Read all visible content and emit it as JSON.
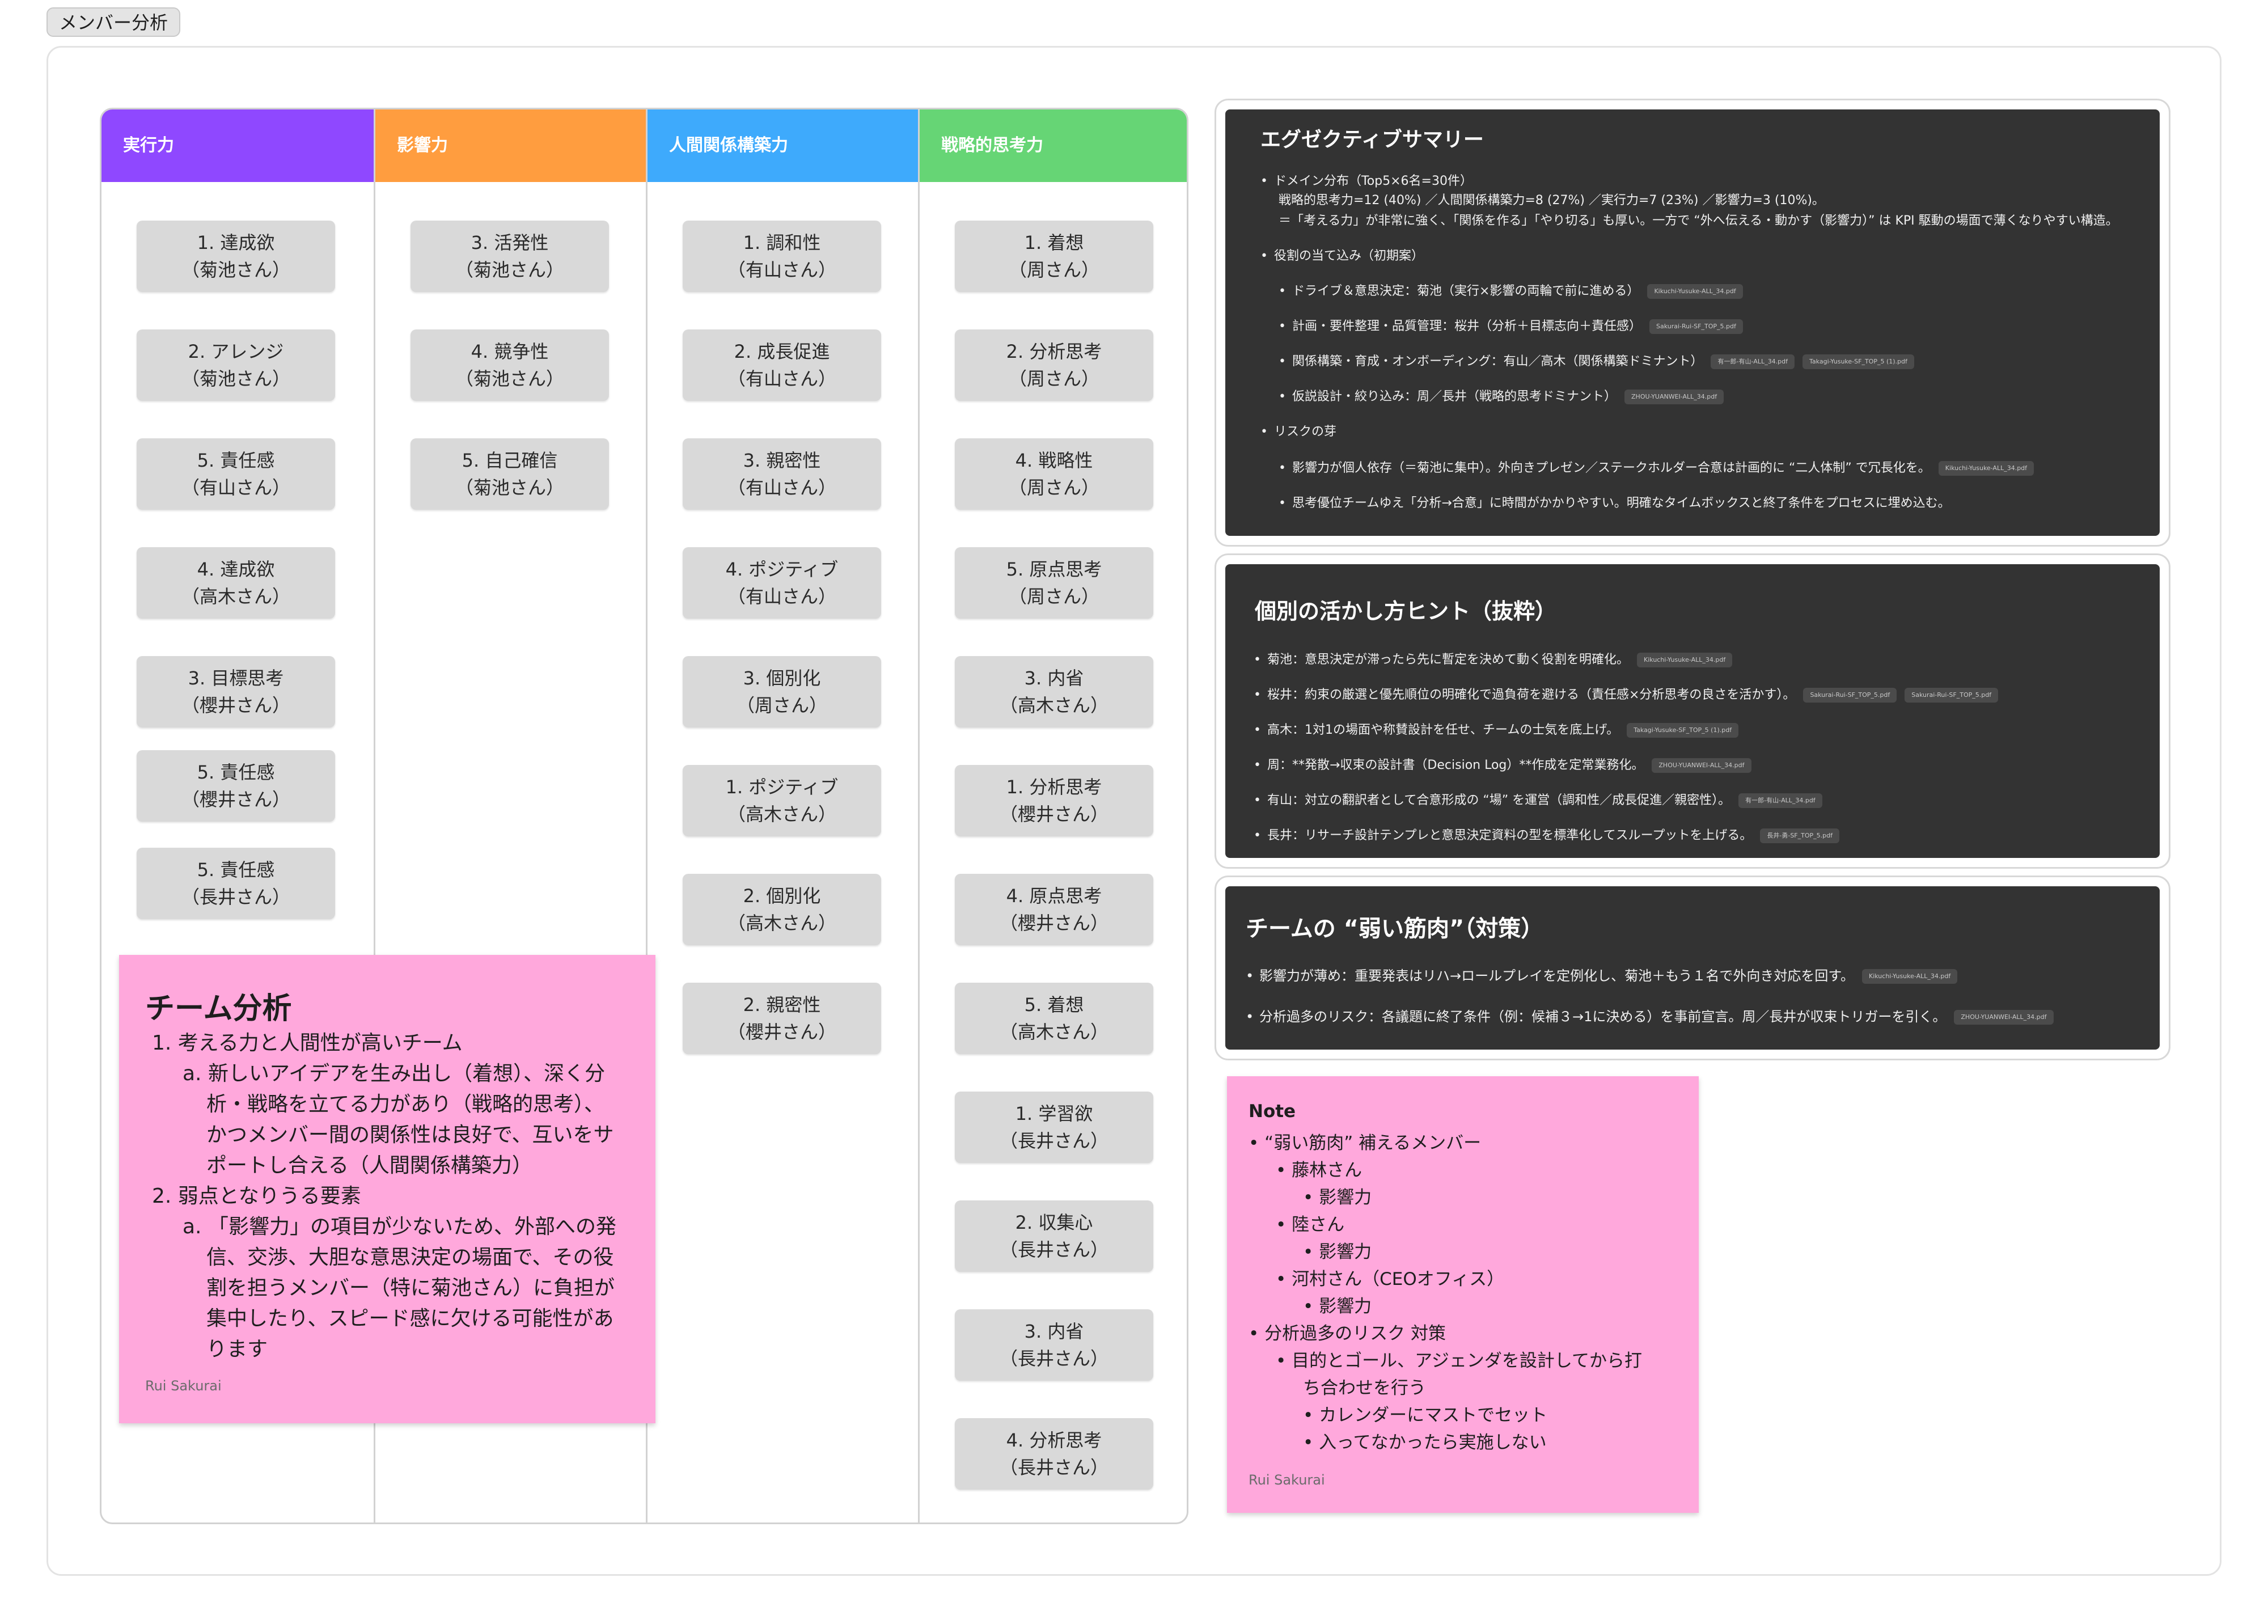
{
  "section": {
    "label": "メンバー分析"
  },
  "board": {
    "columns": [
      {
        "title": "実行力",
        "color": "#8f48ff",
        "cards": [
          [
            "1. 達成欲",
            "（菊池さん）"
          ],
          [
            "2. アレンジ",
            "（菊池さん）"
          ],
          [
            "5. 責任感",
            "（有山さん）"
          ],
          [
            "4. 達成欲",
            "（高木さん）"
          ],
          [
            "3. 目標思考",
            "（櫻井さん）"
          ],
          [
            "5. 責任感",
            "（櫻井さん）"
          ],
          [
            "5. 責任感",
            "（長井さん）"
          ]
        ]
      },
      {
        "title": "影響力",
        "color": "#ff9d3f",
        "cards": [
          [
            "3. 活発性",
            "（菊池さん）"
          ],
          [
            "4. 競争性",
            "（菊池さん）"
          ],
          [
            "5. 自己確信",
            "（菊池さん）"
          ]
        ]
      },
      {
        "title": "人間関係構築力",
        "color": "#3eaafc",
        "cards": [
          [
            "1. 調和性",
            "（有山さん）"
          ],
          [
            "2. 成長促進",
            "（有山さん）"
          ],
          [
            "3. 親密性",
            "（有山さん）"
          ],
          [
            "4. ポジティブ",
            "（有山さん）"
          ],
          [
            "3. 個別化",
            "（周さん）"
          ],
          [
            "1. ポジティブ",
            "（高木さん）"
          ],
          [
            "2. 個別化",
            "（高木さん）"
          ],
          [
            "2. 親密性",
            "（櫻井さん）"
          ]
        ]
      },
      {
        "title": "戦略的思考力",
        "color": "#66d575",
        "cards": [
          [
            "1. 着想",
            "（周さん）"
          ],
          [
            "2. 分析思考",
            "（周さん）"
          ],
          [
            "4. 戦略性",
            "（周さん）"
          ],
          [
            "5. 原点思考",
            "（周さん）"
          ],
          [
            "3. 内省",
            "（高木さん）"
          ],
          [
            "1. 分析思考",
            "（櫻井さん）"
          ],
          [
            "4. 原点思考",
            "（櫻井さん）"
          ],
          [
            "5. 着想",
            "（高木さん）"
          ],
          [
            "1. 学習欲",
            "（長井さん）"
          ],
          [
            "2. 収集心",
            "（長井さん）"
          ],
          [
            "3. 内省",
            "（長井さん）"
          ],
          [
            "4. 分析思考",
            "（長井さん）"
          ]
        ]
      }
    ]
  },
  "executive_summary": {
    "title": "エグゼクティブサマリー",
    "lines": [
      {
        "text": "ドメイン分布（Top5×6名=30件）",
        "bullet": true,
        "indent": 0
      },
      {
        "text": "戦略的思考力=12 (40%) ／人間関係構築力=8 (27%) ／実行力=7 (23%) ／影響力=3 (10%)。",
        "bullet": false,
        "indent": 1
      },
      {
        "text": "＝「考える力」が非常に強く、「関係を作る」「やり切る」も厚い。一方で “外へ伝える・動かす（影響力）” は KPI 駆動の場面で薄くなりやすい構造。",
        "bullet": false,
        "indent": 1
      },
      {
        "text": "役割の当て込み（初期案）",
        "bullet": true,
        "indent": 0
      },
      {
        "text": "ドライブ＆意思決定：菊池（実行×影響の両輪で前に進める）",
        "bullet": true,
        "indent": 1,
        "chips": [
          "Kikuchi-Yusuke-ALL_34.pdf"
        ]
      },
      {
        "text": "計画・要件整理・品質管理：桜井（分析＋目標志向＋責任感）",
        "bullet": true,
        "indent": 1,
        "chips": [
          "Sakurai-Rui-SF_TOP_5.pdf"
        ]
      },
      {
        "text": "関係構築・育成・オンボーディング：有山／高木（関係構築ドミナント）",
        "bullet": true,
        "indent": 1,
        "chips": [
          "有一郎-有山-ALL_34.pdf",
          "Takagi-Yusuke-SF_TOP_5 (1).pdf"
        ]
      },
      {
        "text": "仮説設計・絞り込み：周／長井（戦略的思考ドミナント）",
        "bullet": true,
        "indent": 1,
        "chips": [
          "ZHOU-YUANWEI-ALL_34.pdf"
        ]
      },
      {
        "text": "リスクの芽",
        "bullet": true,
        "indent": 0
      },
      {
        "text": "影響力が個人依存（＝菊池に集中）。外向きプレゼン／ステークホルダー合意は計画的に “二人体制” で冗長化を。",
        "bullet": true,
        "indent": 1,
        "chips": [
          "Kikuchi-Yusuke-ALL_34.pdf"
        ]
      },
      {
        "text": "思考優位チームゆえ「分析→合意」に時間がかかりやすい。明確なタイムボックスと終了条件をプロセスに埋め込む。",
        "bullet": true,
        "indent": 1
      }
    ]
  },
  "hints": {
    "title": "個別の活かし方ヒント（抜粋）",
    "lines": [
      {
        "text": "菊池：意思決定が滞ったら先に暫定を決めて動く役割を明確化。",
        "chips": [
          "Kikuchi-Yusuke-ALL_34.pdf"
        ]
      },
      {
        "text": "桜井：約束の厳選と優先順位の明確化で過負荷を避ける（責任感×分析思考の良さを活かす）。",
        "chips": [
          "Sakurai-Rui-SF_TOP_5.pdf",
          "Sakurai-Rui-SF_TOP_5.pdf"
        ]
      },
      {
        "text": "高木：1対1の場面や称賛設計を任せ、チームの士気を底上げ。",
        "chips": [
          "Takagi-Yusuke-SF_TOP_5 (1).pdf"
        ]
      },
      {
        "text": "周：**発散→収束の設計書（Decision Log）**作成を定常業務化。",
        "chips": [
          "ZHOU-YUANWEI-ALL_34.pdf"
        ]
      },
      {
        "text": "有山：対立の翻訳者として合意形成の “場” を運営（調和性／成長促進／親密性）。",
        "chips": [
          "有一郎-有山-ALL_34.pdf"
        ]
      },
      {
        "text": "長井：リサーチ設計テンプレと意思決定資料の型を標準化してスループットを上げる。",
        "chips": [
          "長井-勇-SF_TOP_5.pdf"
        ]
      }
    ]
  },
  "weak": {
    "title": "チームの “弱い筋肉”（対策）",
    "lines": [
      {
        "text": "影響力が薄め：重要発表はリハ→ロールプレイを定例化し、菊池＋もう１名で外向き対応を回す。",
        "chips": [
          "Kikuchi-Yusuke-ALL_34.pdf"
        ]
      },
      {
        "text": "分析過多のリスク：各議題に終了条件（例：候補３→1に決める）を事前宣言。周／長井が収束トリガーを引く。",
        "chips": [
          "ZHOU-YUANWEI-ALL_34.pdf"
        ]
      }
    ]
  },
  "sticky_team": {
    "title": "チーム分析",
    "lines": [
      "1. 考える力と人間性が高いチーム",
      "a. 新しいアイデアを生み出し（着想）、深く分",
      "析・戦略を立てる力があり（戦略的思考）、",
      "かつメンバー間の関係性は良好で、互いをサ",
      "ポートし合える（人間関係構築力）",
      "2. 弱点となりうる要素",
      "a. 「影響力」の項目が少ないため、外部への発",
      "信、交渉、大胆な意思決定の場面で、その役",
      "割を担うメンバー（特に菊池さん）に負担が",
      "集中したり、スピード感に欠ける可能性があ",
      "ります"
    ],
    "author": "Rui Sakurai"
  },
  "sticky_note": {
    "title": "Note",
    "lines": [
      "• “弱い筋肉” 補えるメンバー",
      "• 藤林さん",
      "• 影響力",
      "• 陸さん",
      "• 影響力",
      "• 河村さん（CEOオフィス）",
      "• 影響力",
      "• 分析過多のリスク 対策",
      "• 目的とゴール、アジェンダを設計してから打",
      "ち合わせを行う",
      "• カレンダーにマストでセット",
      "• 入ってなかったら実施しない"
    ],
    "author": "Rui Sakurai"
  }
}
